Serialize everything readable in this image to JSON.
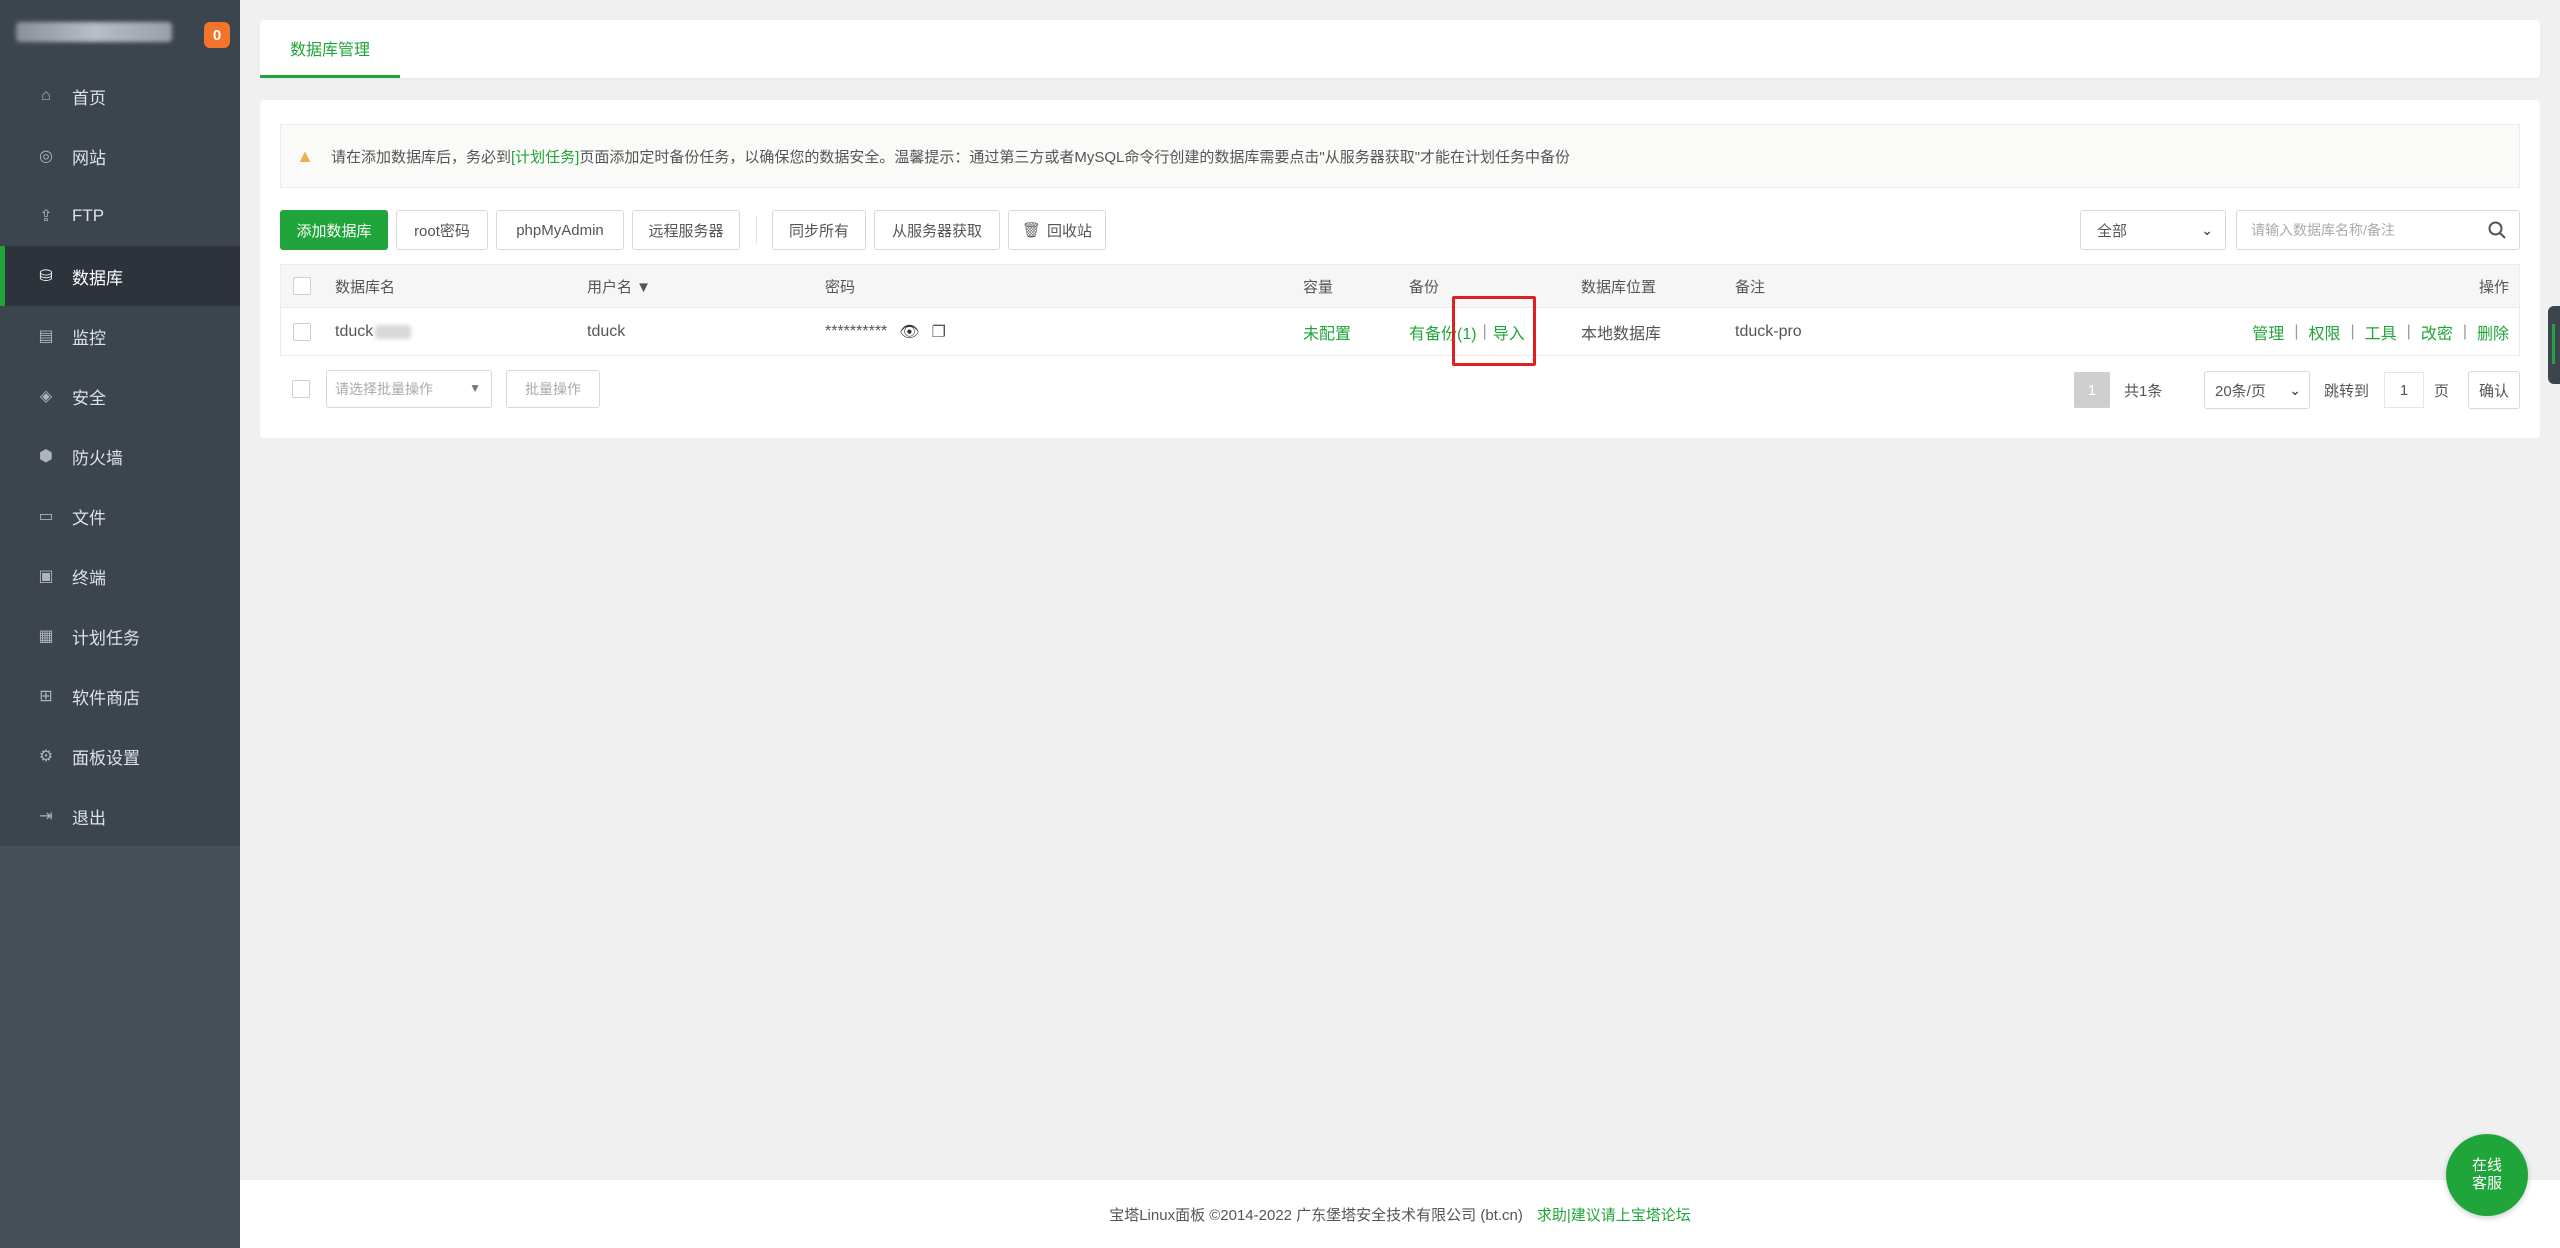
{
  "sidebar": {
    "badge": "0",
    "items": [
      {
        "label": "首页",
        "icon": "home-icon",
        "glyph": "⌂"
      },
      {
        "label": "网站",
        "icon": "globe-icon",
        "glyph": "◎"
      },
      {
        "label": "FTP",
        "icon": "ftp-icon",
        "glyph": "⇪"
      },
      {
        "label": "数据库",
        "icon": "database-icon",
        "glyph": "⛁"
      },
      {
        "label": "监控",
        "icon": "monitor-icon",
        "glyph": "▤"
      },
      {
        "label": "安全",
        "icon": "shield-icon",
        "glyph": "◈"
      },
      {
        "label": "防火墙",
        "icon": "firewall-icon",
        "glyph": "⬢"
      },
      {
        "label": "文件",
        "icon": "folder-icon",
        "glyph": "▭"
      },
      {
        "label": "终端",
        "icon": "terminal-icon",
        "glyph": "▣"
      },
      {
        "label": "计划任务",
        "icon": "calendar-icon",
        "glyph": "▦"
      },
      {
        "label": "软件商店",
        "icon": "apps-icon",
        "glyph": "⊞"
      },
      {
        "label": "面板设置",
        "icon": "settings-icon",
        "glyph": "⚙"
      },
      {
        "label": "退出",
        "icon": "logout-icon",
        "glyph": "⇥"
      }
    ],
    "active_index": 3
  },
  "tabs": [
    {
      "label": "数据库管理"
    }
  ],
  "alert": {
    "text_before": "请在添加数据库后，务必到",
    "link": "[计划任务]",
    "text_after": "页面添加定时备份任务，以确保您的数据安全。温馨提示：通过第三方或者MySQL命令行创建的数据库需要点击\"从服务器获取\"才能在计划任务中备份"
  },
  "toolbar": {
    "add_db": "添加数据库",
    "root_password": "root密码",
    "phpmyadmin": "phpMyAdmin",
    "remote_server": "远程服务器",
    "sync_all": "同步所有",
    "fetch_from_server": "从服务器获取",
    "recycle_bin": "回收站",
    "filter_value": "全部",
    "search_placeholder": "请输入数据库名称/备注"
  },
  "table": {
    "headers": {
      "name": "数据库名",
      "user": "用户名 ▼",
      "password": "密码",
      "capacity": "容量",
      "backup": "备份",
      "location": "数据库位置",
      "remark": "备注",
      "actions": "操作"
    },
    "rows": [
      {
        "name": "tduck",
        "user": "tduck",
        "password": "**********",
        "capacity": "未配置",
        "backup": "有备份(1)",
        "import": "导入",
        "location": "本地数据库",
        "remark": "tduck-pro",
        "actions": [
          "管理",
          "权限",
          "工具",
          "改密",
          "删除"
        ]
      }
    ]
  },
  "batch": {
    "placeholder": "请选择批量操作",
    "button": "批量操作"
  },
  "pager": {
    "current": "1",
    "total": "共1条",
    "per_page": "20条/页",
    "jump_label": "跳转到",
    "jump_value": "1",
    "page_unit": "页",
    "confirm": "确认"
  },
  "footer": {
    "copyright": "宝塔Linux面板 ©2014-2022 广东堡塔安全技术有限公司 (bt.cn)",
    "link": "求助|建议请上宝塔论坛"
  },
  "float_help": {
    "line1": "在线",
    "line2": "客服"
  },
  "colors": {
    "accent": "#20a53a",
    "sidebar": "#3c444d",
    "highlight": "#e02020"
  }
}
